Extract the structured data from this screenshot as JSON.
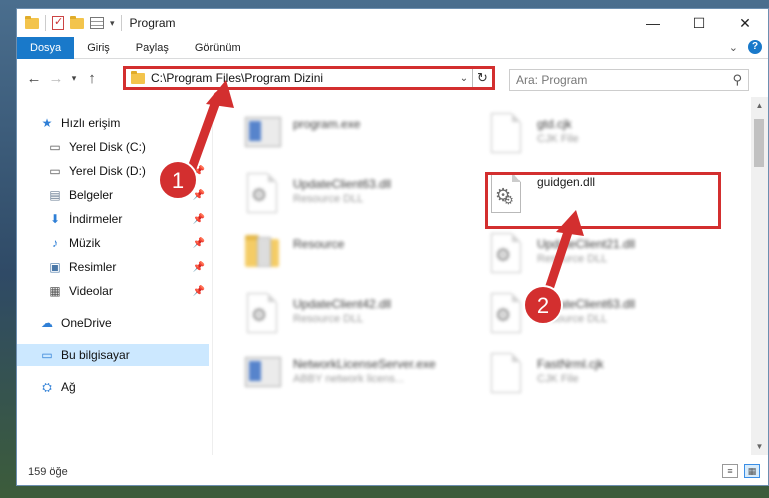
{
  "window": {
    "title": "Program",
    "controls": {
      "minimize": "—",
      "maximize": "☐",
      "close": "✕"
    }
  },
  "ribbon": {
    "tabs": [
      "Dosya",
      "Giriş",
      "Paylaş",
      "Görünüm"
    ],
    "expand_icon": "⌄",
    "help_icon": "?"
  },
  "address": {
    "path": "C:\\Program Files\\Program Dizini",
    "search_placeholder": "Ara: Program"
  },
  "navpane": {
    "items": [
      {
        "label": "Hızlı erişim",
        "icon": "star-icon",
        "glyph": "★",
        "color": "#2f7fd6"
      },
      {
        "label": "Yerel Disk (C:)",
        "icon": "drive-icon",
        "glyph": "▭",
        "color": "#555555"
      },
      {
        "label": "Yerel Disk (D:)",
        "icon": "drive-icon",
        "glyph": "▭",
        "color": "#555555"
      },
      {
        "label": "Belgeler",
        "icon": "documents-icon",
        "glyph": "▤",
        "color": "#6a7d93"
      },
      {
        "label": "İndirmeler",
        "icon": "download-icon",
        "glyph": "⬇",
        "color": "#2f7fd6"
      },
      {
        "label": "Müzik",
        "icon": "music-icon",
        "glyph": "♪",
        "color": "#2f7fd6"
      },
      {
        "label": "Resimler",
        "icon": "pictures-icon",
        "glyph": "▣",
        "color": "#4a78a8"
      },
      {
        "label": "Videolar",
        "icon": "videos-icon",
        "glyph": "▦",
        "color": "#555555"
      },
      {
        "label": "OneDrive",
        "icon": "cloud-icon",
        "glyph": "☁",
        "color": "#2f7fd6"
      },
      {
        "label": "Bu bilgisayar",
        "icon": "computer-icon",
        "glyph": "▭",
        "color": "#2f7fd6"
      },
      {
        "label": "Ağ",
        "icon": "network-icon",
        "glyph": "⛭",
        "color": "#2f7fd6"
      }
    ]
  },
  "files": [
    {
      "name": "program.exe",
      "desc": "",
      "kind": "exe"
    },
    {
      "name": "gtd.cjk",
      "desc": "CJK File",
      "kind": "doc"
    },
    {
      "name": "UpdateClient63.dll",
      "desc": "Resource DLL",
      "kind": "dll"
    },
    {
      "name": "guidgen.dll",
      "desc": "",
      "kind": "dll"
    },
    {
      "name": "Resource",
      "desc": "",
      "kind": "folder"
    },
    {
      "name": "UpdateClient21.dll",
      "desc": "Resource DLL",
      "kind": "dll"
    },
    {
      "name": "UpdateClient42.dll",
      "desc": "Resource DLL",
      "kind": "dll"
    },
    {
      "name": "UpdateClient63.dll",
      "desc": "Resource DLL",
      "kind": "dll"
    },
    {
      "name": "NetworkLicenseServer.exe",
      "desc": "ABBY network licens...",
      "kind": "exe"
    },
    {
      "name": "FastNrml.cjk",
      "desc": "CJK File",
      "kind": "doc"
    }
  ],
  "status": {
    "count": "159 öğe"
  },
  "annotations": {
    "step1": "1",
    "step2": "2",
    "accent": "#d32f2f"
  }
}
